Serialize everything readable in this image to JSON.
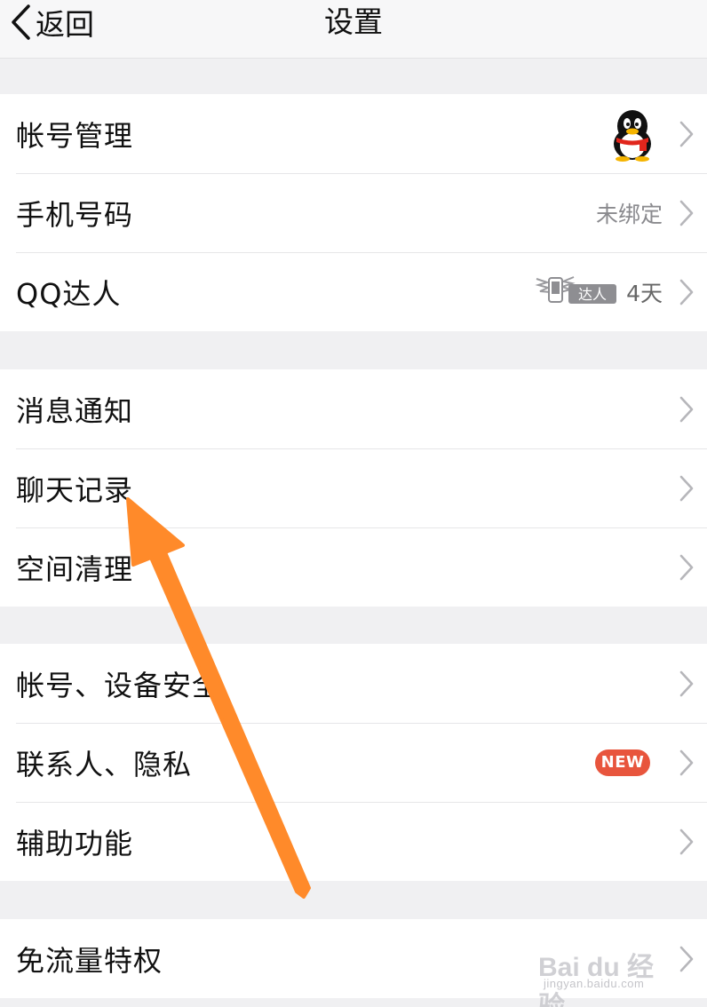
{
  "nav": {
    "back_label": "返回",
    "title": "设置"
  },
  "groups": [
    {
      "items": [
        {
          "label": "帐号管理",
          "right": {
            "type": "avatar",
            "icon": "qq-penguin-avatar"
          }
        },
        {
          "label": "手机号码",
          "right": {
            "type": "text",
            "text": "未绑定"
          }
        },
        {
          "label": "QQ达人",
          "right": {
            "type": "badge",
            "badge_text": "达人",
            "text": "4天",
            "icon": "winged-phone-icon"
          }
        }
      ]
    },
    {
      "items": [
        {
          "label": "消息通知"
        },
        {
          "label": "聊天记录"
        },
        {
          "label": "空间清理"
        }
      ]
    },
    {
      "items": [
        {
          "label": "帐号、设备安全"
        },
        {
          "label": "联系人、隐私",
          "right": {
            "type": "new",
            "text": "NEW"
          }
        },
        {
          "label": "辅助功能"
        }
      ]
    },
    {
      "items": [
        {
          "label": "免流量特权"
        }
      ]
    }
  ],
  "annotation": {
    "type": "orange-arrow",
    "color": "#ff8a2a",
    "points_to": "聊天记录"
  },
  "watermark": {
    "main": "Bai du 经验",
    "sub": "jingyan.baidu.com"
  },
  "colors": {
    "background": "#f0f0f2",
    "row_background": "#ffffff",
    "secondary_text": "#8a8a8e",
    "new_badge": "#e8553d",
    "arrow": "#ff8a2a"
  }
}
